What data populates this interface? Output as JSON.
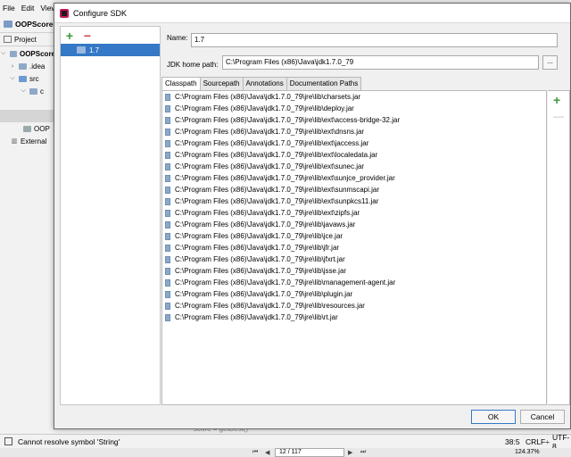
{
  "ide": {
    "menu": [
      "File",
      "Edit",
      "View"
    ],
    "breadcrumb": "OOPScore",
    "project_label": "Project",
    "tree": [
      {
        "label": "OOPScore",
        "bold": true
      },
      {
        "label": ".idea"
      },
      {
        "label": "src"
      },
      {
        "label": "c"
      },
      {
        "label": ""
      },
      {
        "label": ""
      },
      {
        "label": "OOP"
      },
      {
        "label": "External"
      }
    ],
    "editor_line": "score = getBest()",
    "status_message": "Cannot resolve symbol 'String'",
    "status_position": "38:5",
    "status_line_sep": "CRLF÷",
    "status_encoding": "UTF-8",
    "page": "12 / 117",
    "zoom": "124.37%"
  },
  "dialog": {
    "title": "Configure SDK",
    "sdk_list": [
      "1.7"
    ],
    "name_label": "Name:",
    "name_value": "1.7",
    "home_label": "JDK home path:",
    "home_value": "C:\\Program Files (x86)\\Java\\jdk1.7.0_79",
    "browse_label": "...",
    "tabs": [
      "Classpath",
      "Sourcepath",
      "Annotations",
      "Documentation Paths"
    ],
    "active_tab": "Classpath",
    "classpath": [
      "C:\\Program Files (x86)\\Java\\jdk1.7.0_79\\jre\\lib\\charsets.jar",
      "C:\\Program Files (x86)\\Java\\jdk1.7.0_79\\jre\\lib\\deploy.jar",
      "C:\\Program Files (x86)\\Java\\jdk1.7.0_79\\jre\\lib\\ext\\access-bridge-32.jar",
      "C:\\Program Files (x86)\\Java\\jdk1.7.0_79\\jre\\lib\\ext\\dnsns.jar",
      "C:\\Program Files (x86)\\Java\\jdk1.7.0_79\\jre\\lib\\ext\\jaccess.jar",
      "C:\\Program Files (x86)\\Java\\jdk1.7.0_79\\jre\\lib\\ext\\localedata.jar",
      "C:\\Program Files (x86)\\Java\\jdk1.7.0_79\\jre\\lib\\ext\\sunec.jar",
      "C:\\Program Files (x86)\\Java\\jdk1.7.0_79\\jre\\lib\\ext\\sunjce_provider.jar",
      "C:\\Program Files (x86)\\Java\\jdk1.7.0_79\\jre\\lib\\ext\\sunmscapi.jar",
      "C:\\Program Files (x86)\\Java\\jdk1.7.0_79\\jre\\lib\\ext\\sunpkcs11.jar",
      "C:\\Program Files (x86)\\Java\\jdk1.7.0_79\\jre\\lib\\ext\\zipfs.jar",
      "C:\\Program Files (x86)\\Java\\jdk1.7.0_79\\jre\\lib\\javaws.jar",
      "C:\\Program Files (x86)\\Java\\jdk1.7.0_79\\jre\\lib\\jce.jar",
      "C:\\Program Files (x86)\\Java\\jdk1.7.0_79\\jre\\lib\\jfr.jar",
      "C:\\Program Files (x86)\\Java\\jdk1.7.0_79\\jre\\lib\\jfxrt.jar",
      "C:\\Program Files (x86)\\Java\\jdk1.7.0_79\\jre\\lib\\jsse.jar",
      "C:\\Program Files (x86)\\Java\\jdk1.7.0_79\\jre\\lib\\management-agent.jar",
      "C:\\Program Files (x86)\\Java\\jdk1.7.0_79\\jre\\lib\\plugin.jar",
      "C:\\Program Files (x86)\\Java\\jdk1.7.0_79\\jre\\lib\\resources.jar",
      "C:\\Program Files (x86)\\Java\\jdk1.7.0_79\\jre\\lib\\rt.jar"
    ],
    "ok_label": "OK",
    "cancel_label": "Cancel"
  },
  "colors": {
    "selection": "#3478c6",
    "add_green": "#3c9a3c",
    "remove_red": "#cc4444"
  }
}
